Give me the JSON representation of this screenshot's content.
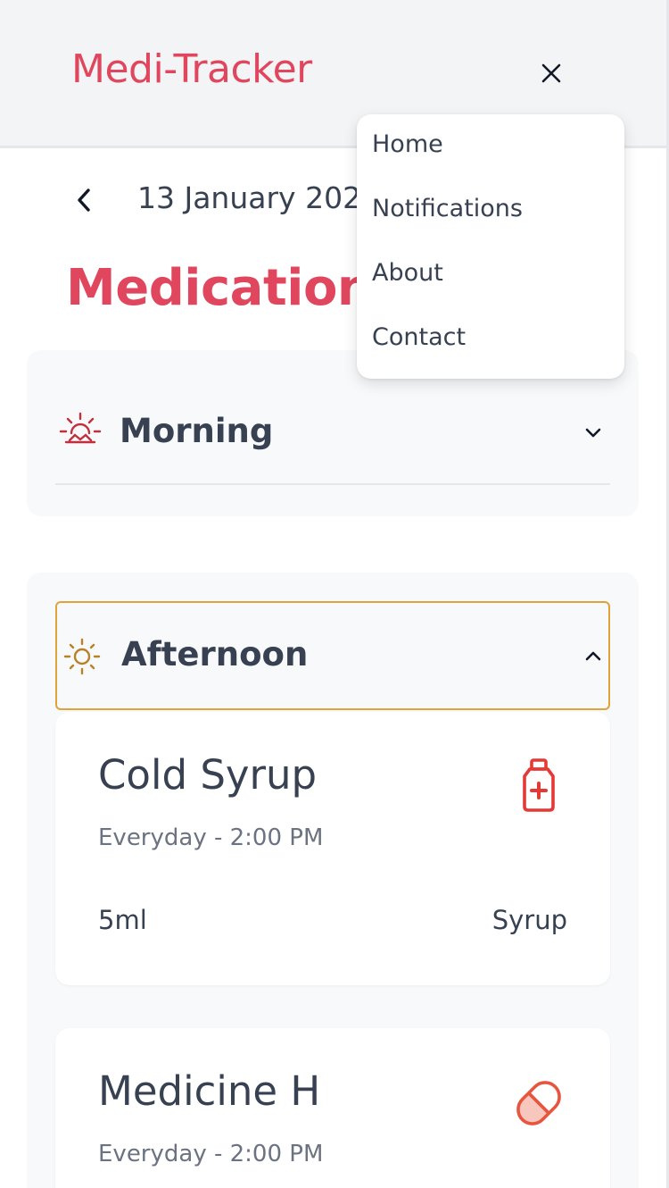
{
  "header": {
    "brand": "Medi-Tracker",
    "close_icon": "close-icon"
  },
  "date_nav": {
    "back_icon": "chevron-left-icon",
    "date": "13 January 2024"
  },
  "page_title": "Medication",
  "menu": {
    "items": [
      {
        "label": "Home"
      },
      {
        "label": "Notifications"
      },
      {
        "label": "About"
      },
      {
        "label": "Contact"
      }
    ]
  },
  "sections": [
    {
      "title": "Morning",
      "icon": "sunrise-icon",
      "expanded": false,
      "chevron_icon": "chevron-down-icon"
    },
    {
      "title": "Afternoon",
      "icon": "sun-icon",
      "expanded": true,
      "chevron_icon": "chevron-up-icon",
      "medications": [
        {
          "name": "Cold Syrup",
          "schedule": "Everyday - 2:00 PM",
          "dose": "5ml",
          "type": "Syrup",
          "icon": "syrup-bottle-icon"
        },
        {
          "name": "Medicine H",
          "schedule": "Everyday - 2:00 PM",
          "icon": "pill-capsule-icon"
        }
      ]
    }
  ],
  "colors": {
    "brand": "#e0475e",
    "morning_icon": "#c0313d",
    "afternoon_icon": "#b8822a",
    "afternoon_border": "#e0a33a",
    "syrup_icon": "#e53935",
    "pill_icon": "#e8553f",
    "text_primary": "#374151",
    "text_secondary": "#6b7280"
  }
}
